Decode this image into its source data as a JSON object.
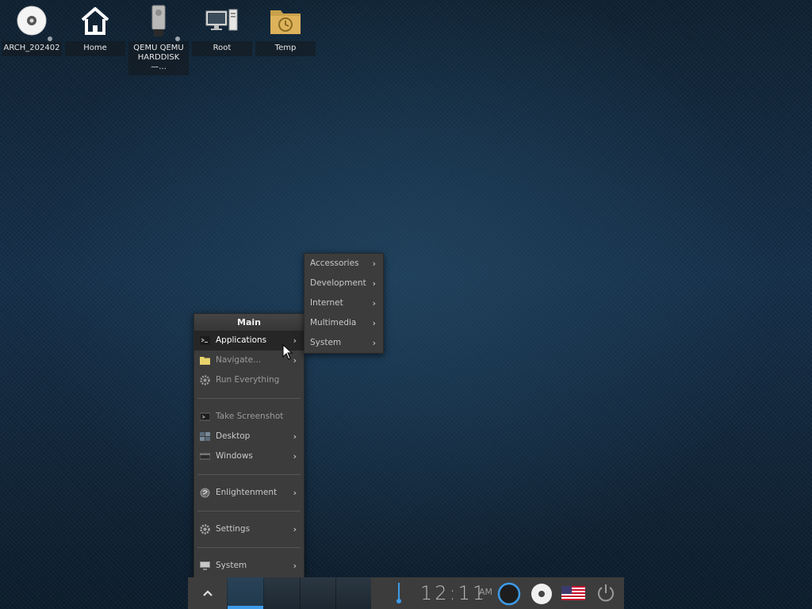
{
  "desktop_icons": [
    {
      "label": "ARCH_202402",
      "icon": "optical-disc-icon"
    },
    {
      "label": "Home",
      "icon": "home-icon"
    },
    {
      "label": "QEMU QEMU HARDDISK—...",
      "icon": "usb-drive-icon"
    },
    {
      "label": "Root",
      "icon": "computer-icon"
    },
    {
      "label": "Temp",
      "icon": "temp-folder-icon"
    }
  ],
  "main_menu": {
    "title": "Main",
    "items": [
      {
        "label": "Applications",
        "icon": "terminal-icon",
        "submenu": true
      },
      {
        "label": "Navigate...",
        "icon": "folder-icon",
        "submenu": true
      },
      {
        "label": "Run Everything",
        "icon": "gear-icon",
        "submenu": false
      },
      {
        "label": "Take Screenshot",
        "icon": "screenshot-icon",
        "submenu": false
      },
      {
        "label": "Desktop",
        "icon": "desktop-icon",
        "submenu": true
      },
      {
        "label": "Windows",
        "icon": "windows-icon",
        "submenu": true
      },
      {
        "label": "Enlightenment",
        "icon": "enlightenment-icon",
        "submenu": true
      },
      {
        "label": "Settings",
        "icon": "settings-icon",
        "submenu": true
      },
      {
        "label": "System",
        "icon": "monitor-icon",
        "submenu": true
      }
    ]
  },
  "applications_submenu": {
    "items": [
      {
        "label": "Accessories"
      },
      {
        "label": "Development"
      },
      {
        "label": "Internet"
      },
      {
        "label": "Multimedia"
      },
      {
        "label": "System"
      }
    ]
  },
  "shelf": {
    "clock_time": "12:11",
    "clock_ampm": "AM",
    "tray": [
      "status-circle-icon",
      "optical-disc-icon",
      "us-flag-icon",
      "power-icon"
    ]
  },
  "colors": {
    "accent": "#3d9be9",
    "menu_bg": "#3c3c3c",
    "menu_active": "#262626"
  }
}
